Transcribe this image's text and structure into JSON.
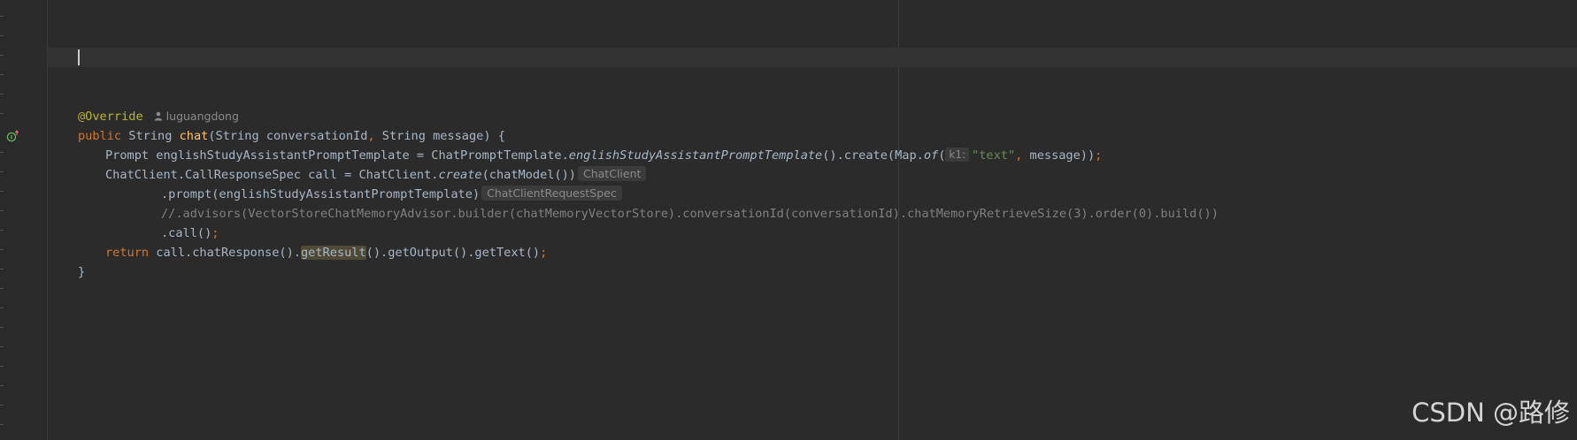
{
  "editor": {
    "annotation": "@Override",
    "author": "luguangdong",
    "method_signature": {
      "kw_public": "public",
      "type_string": "String",
      "name": "chat",
      "params_open": "(String conversationId",
      "comma": ",",
      "params_rest": " String message) {"
    },
    "line_prompt": {
      "lhs": "Prompt englishStudyAssistantPromptTemplate = ChatPromptTemplate.",
      "method_italic": "englishStudyAssistantPromptTemplate",
      "mid": "().create(Map.",
      "of_italic": "of",
      "open_paren": "(",
      "param_hint": "k1:",
      "string_literal": "\"text\"",
      "comma": ",",
      "tail": " message))",
      "semicolon": ";"
    },
    "line_call": {
      "lhs": "ChatClient.CallResponseSpec call = ChatClient.",
      "create_italic": "create",
      "tail": "(chatModel())",
      "type_hint": "ChatClient"
    },
    "line_prompt_chain": {
      "code": ".prompt(englishStudyAssistantPromptTemplate)",
      "type_hint": "ChatClientRequestSpec"
    },
    "line_comment": "//.advisors(VectorStoreChatMemoryAdvisor.builder(chatMemoryVectorStore).conversationId(conversationId).chatMemoryRetrieveSize(3).order(0).build())",
    "line_call_chain": {
      "code": ".call()",
      "semicolon": ";"
    },
    "line_return": {
      "kw_return": "return",
      "pre": " call.chatResponse().",
      "highlighted": "getResult",
      "post": "().getOutput().getText()",
      "semicolon": ";"
    },
    "closing_brace": "}"
  },
  "watermark": "CSDN @路修",
  "colors": {
    "background": "#2b2b2b",
    "keyword": "#cc7832",
    "annotation": "#bbb529",
    "method_declaration": "#ffc66d",
    "string": "#6a8759",
    "comment": "#808080",
    "default_text": "#a9b7c6"
  }
}
